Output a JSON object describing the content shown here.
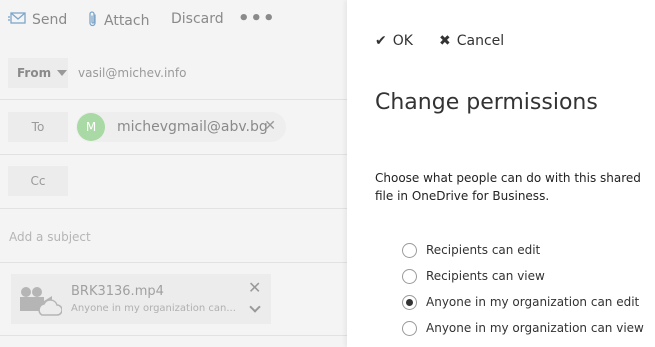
{
  "toolbar": {
    "send_label": "Send",
    "attach_label": "Attach",
    "discard_label": "Discard",
    "more_label": "•••"
  },
  "compose": {
    "from_label": "From",
    "from_address": "vasil@michev.info",
    "to_label": "To",
    "recipient": {
      "initial": "M",
      "name": "michevgmail@abv.bg"
    },
    "cc_label": "Cc",
    "subject_placeholder": "Add a subject",
    "attachment": {
      "name": "BRK3136.mp4",
      "permission": "Anyone in my organization can..."
    }
  },
  "panel": {
    "ok_label": "OK",
    "cancel_label": "Cancel",
    "title": "Change permissions",
    "description": "Choose what people can do with this shared file in OneDrive for Business.",
    "options": [
      {
        "label": "Recipients can edit",
        "selected": false
      },
      {
        "label": "Recipients can view",
        "selected": false
      },
      {
        "label": "Anyone in my organization can edit",
        "selected": true
      },
      {
        "label": "Anyone in my organization can view",
        "selected": false
      }
    ]
  },
  "colors": {
    "avatar": "#a9d9a4",
    "compose_bg": "#f4f4f4",
    "panel_bg": "#ffffff"
  }
}
